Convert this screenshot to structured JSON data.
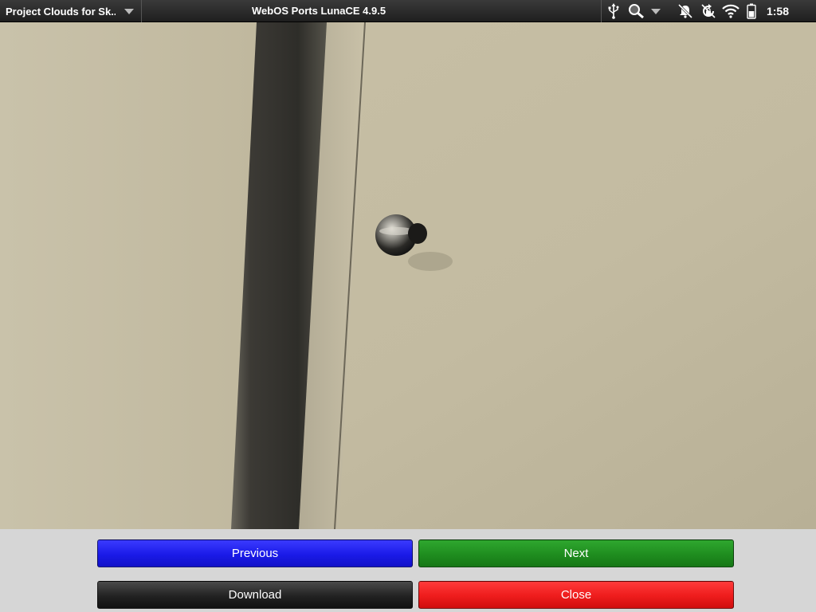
{
  "statusbar": {
    "app_menu_label": "Project Clouds for Sk...",
    "carrier": "WebOS Ports LunaCE 4.9.5",
    "time": "1:58",
    "icons": [
      "usb-icon",
      "search-icon",
      "dropdown-caret-icon",
      "mute-icon",
      "rotation-lock-icon",
      "wifi-icon",
      "battery-icon"
    ]
  },
  "photo": {
    "subject": "grayscale photo of a wall with door edge and keyhole"
  },
  "buttons": {
    "previous": "Previous",
    "next": "Next",
    "download": "Download",
    "close": "Close"
  },
  "colors": {
    "previous": "#1a1ae8",
    "next": "#1f8d1f",
    "download": "#222222",
    "close": "#ee1c1c",
    "panel": "#d6d6d6"
  }
}
